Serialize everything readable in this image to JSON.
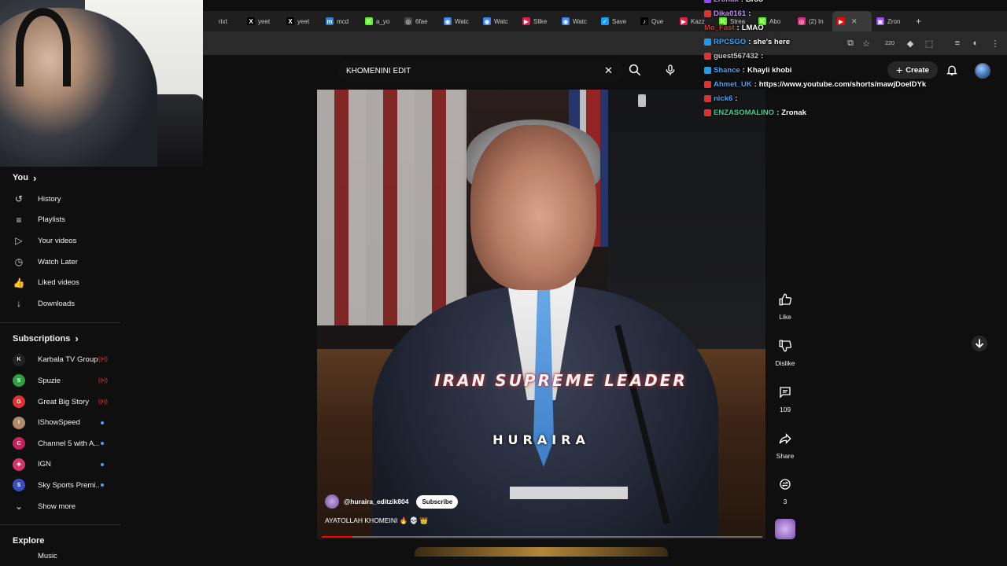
{
  "browser": {
    "tabs": [
      {
        "label": "rixt",
        "fav": "",
        "color": "#1f1f1f"
      },
      {
        "label": "yeet",
        "fav": "X",
        "color": "#000000"
      },
      {
        "label": "yeet",
        "fav": "X",
        "color": "#000000"
      },
      {
        "label": "mcd",
        "fav": "m",
        "color": "#2a7fd4"
      },
      {
        "label": "a_yo",
        "fav": "K",
        "color": "#53fc18"
      },
      {
        "label": "6fae",
        "fav": "◎",
        "color": "#444444"
      },
      {
        "label": "Watc",
        "fav": "◉",
        "color": "#3b82f6"
      },
      {
        "label": "Watc",
        "fav": "◉",
        "color": "#3b82f6"
      },
      {
        "label": "Slike",
        "fav": "▶",
        "color": "#e11d48"
      },
      {
        "label": "Watc",
        "fav": "◉",
        "color": "#3b82f6"
      },
      {
        "label": "Save",
        "fav": "✓",
        "color": "#1d9bf0"
      },
      {
        "label": "Que",
        "fav": "♪",
        "color": "#000000"
      },
      {
        "label": "Kazz",
        "fav": "▶",
        "color": "#e11d48"
      },
      {
        "label": "Strea",
        "fav": "K",
        "color": "#53fc18"
      },
      {
        "label": "Abo",
        "fav": "K",
        "color": "#53fc18"
      },
      {
        "label": "(2) In",
        "fav": "◎",
        "color": "#d62976"
      },
      {
        "label": "",
        "fav": "▶",
        "color": "#ff0000",
        "active": true
      },
      {
        "label": "Zron",
        "fav": "▣",
        "color": "#9146ff"
      }
    ],
    "tab_close": "✕",
    "new_tab": "+",
    "toolbar_badge": "220"
  },
  "search": {
    "query": "KHOMENINI EDIT",
    "clear_icon": "close-icon",
    "search_icon": "search-icon",
    "mic_icon": "microphone-icon"
  },
  "topbar": {
    "create_label": "Create",
    "create_plus": "+"
  },
  "sidebar": {
    "you_label": "You",
    "chevron": "›",
    "items": [
      {
        "label": "History",
        "icon": "↺"
      },
      {
        "label": "Playlists",
        "icon": "≡"
      },
      {
        "label": "Your videos",
        "icon": "▷"
      },
      {
        "label": "Watch Later",
        "icon": "◷"
      },
      {
        "label": "Liked videos",
        "icon": "👍"
      },
      {
        "label": "Downloads",
        "icon": "↓"
      }
    ],
    "subscriptions_label": "Subscriptions",
    "subscriptions": [
      {
        "name": "Karbala TV Group",
        "color": "#222222",
        "status": "live",
        "initial": "K"
      },
      {
        "name": "Spuzie",
        "color": "#2f9e44",
        "status": "live",
        "initial": "S"
      },
      {
        "name": "Great Big Story",
        "color": "#e03131",
        "status": "live",
        "initial": "G"
      },
      {
        "name": "IShowSpeed",
        "color": "#b08968",
        "status": "new",
        "initial": "I"
      },
      {
        "name": "Channel 5 with A...",
        "color": "#c2255c",
        "status": "new",
        "initial": "C"
      },
      {
        "name": "IGN",
        "color": "#d6336c",
        "status": "new",
        "initial": "✚"
      },
      {
        "name": "Sky Sports Premi...",
        "color": "#364fc7",
        "status": "new",
        "initial": "S"
      }
    ],
    "live_glyph": "((•))",
    "show_more_label": "Show more",
    "show_more_icon": "⌄",
    "explore_label": "Explore",
    "music_label": "Music"
  },
  "short": {
    "overlay_line1": "IRAN SUPREME LEADER",
    "overlay_line2": "HURAIRA",
    "channel_handle": "@huraira_editzik804",
    "subscribe_label": "Subscribe",
    "title": "AYATOLLAH KHOMEINI 🔥 💀 👑",
    "progress": 0.07
  },
  "actions": {
    "like_label": "Like",
    "dislike_label": "Dislike",
    "comments_count": "109",
    "share_label": "Share",
    "remix_count": "3"
  },
  "chat": [
    {
      "user": "Zronak",
      "msg": "Broo",
      "color": "#c58af9",
      "badge": "#9146ff"
    },
    {
      "user": "Dika0161",
      "msg": "",
      "color": "#c58af9",
      "badge": "#e03131"
    },
    {
      "user": "Mo_Fast",
      "msg": "LMAO",
      "color": "#e03131",
      "badge": ""
    },
    {
      "user": "RPCSGO",
      "msg": "she's here",
      "color": "#3ea6ff",
      "badge": "#1d9bf0"
    },
    {
      "user": "guest567432",
      "msg": "",
      "color": "#c8c8c8",
      "badge": "#e03131"
    },
    {
      "user": "Shance",
      "msg": "Khayli khobi",
      "color": "#3ea6ff",
      "badge": "#1d9bf0"
    },
    {
      "user": "Ahmet_UK",
      "msg": "https://www.youtube.com/shorts/mawjDoeIDYk",
      "color": "#3ea6ff",
      "badge": "#e03131"
    },
    {
      "user": "nick6",
      "msg": "",
      "color": "#3ea6ff",
      "badge": "#e03131"
    },
    {
      "user": "ENZASOMALINO",
      "msg": "Zronak",
      "color": "#3ecf8e",
      "badge": "#e03131"
    }
  ]
}
